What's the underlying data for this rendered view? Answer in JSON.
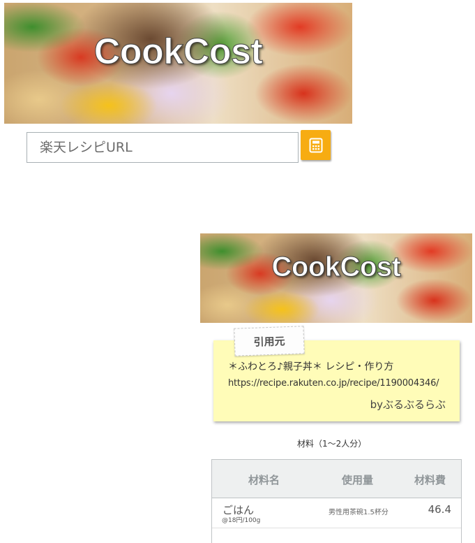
{
  "top": {
    "logo_text": "CookCost",
    "search": {
      "placeholder": "楽天レシピURL"
    },
    "calculate_icon": "calculator-icon"
  },
  "result": {
    "logo_text": "CookCost",
    "source": {
      "tag": "引用元",
      "title": "＊ふわとろ♪親子丼＊ レシピ・作り方",
      "url": "https://recipe.rakuten.co.jp/recipe/1190004346/",
      "author": "byぶるぶるらぶ"
    },
    "ingredients_heading": "材料（1〜2人分）",
    "table": {
      "headers": {
        "name": "材料名",
        "amount": "使用量",
        "cost": "材料費"
      },
      "rows": [
        {
          "name": "ごはん",
          "unit_price": "@18円/100g",
          "amount": "男性用茶碗1.5杯分",
          "cost": "46.4"
        },
        {
          "name": "",
          "unit_price": "",
          "amount": "",
          "cost": ""
        }
      ]
    }
  }
}
